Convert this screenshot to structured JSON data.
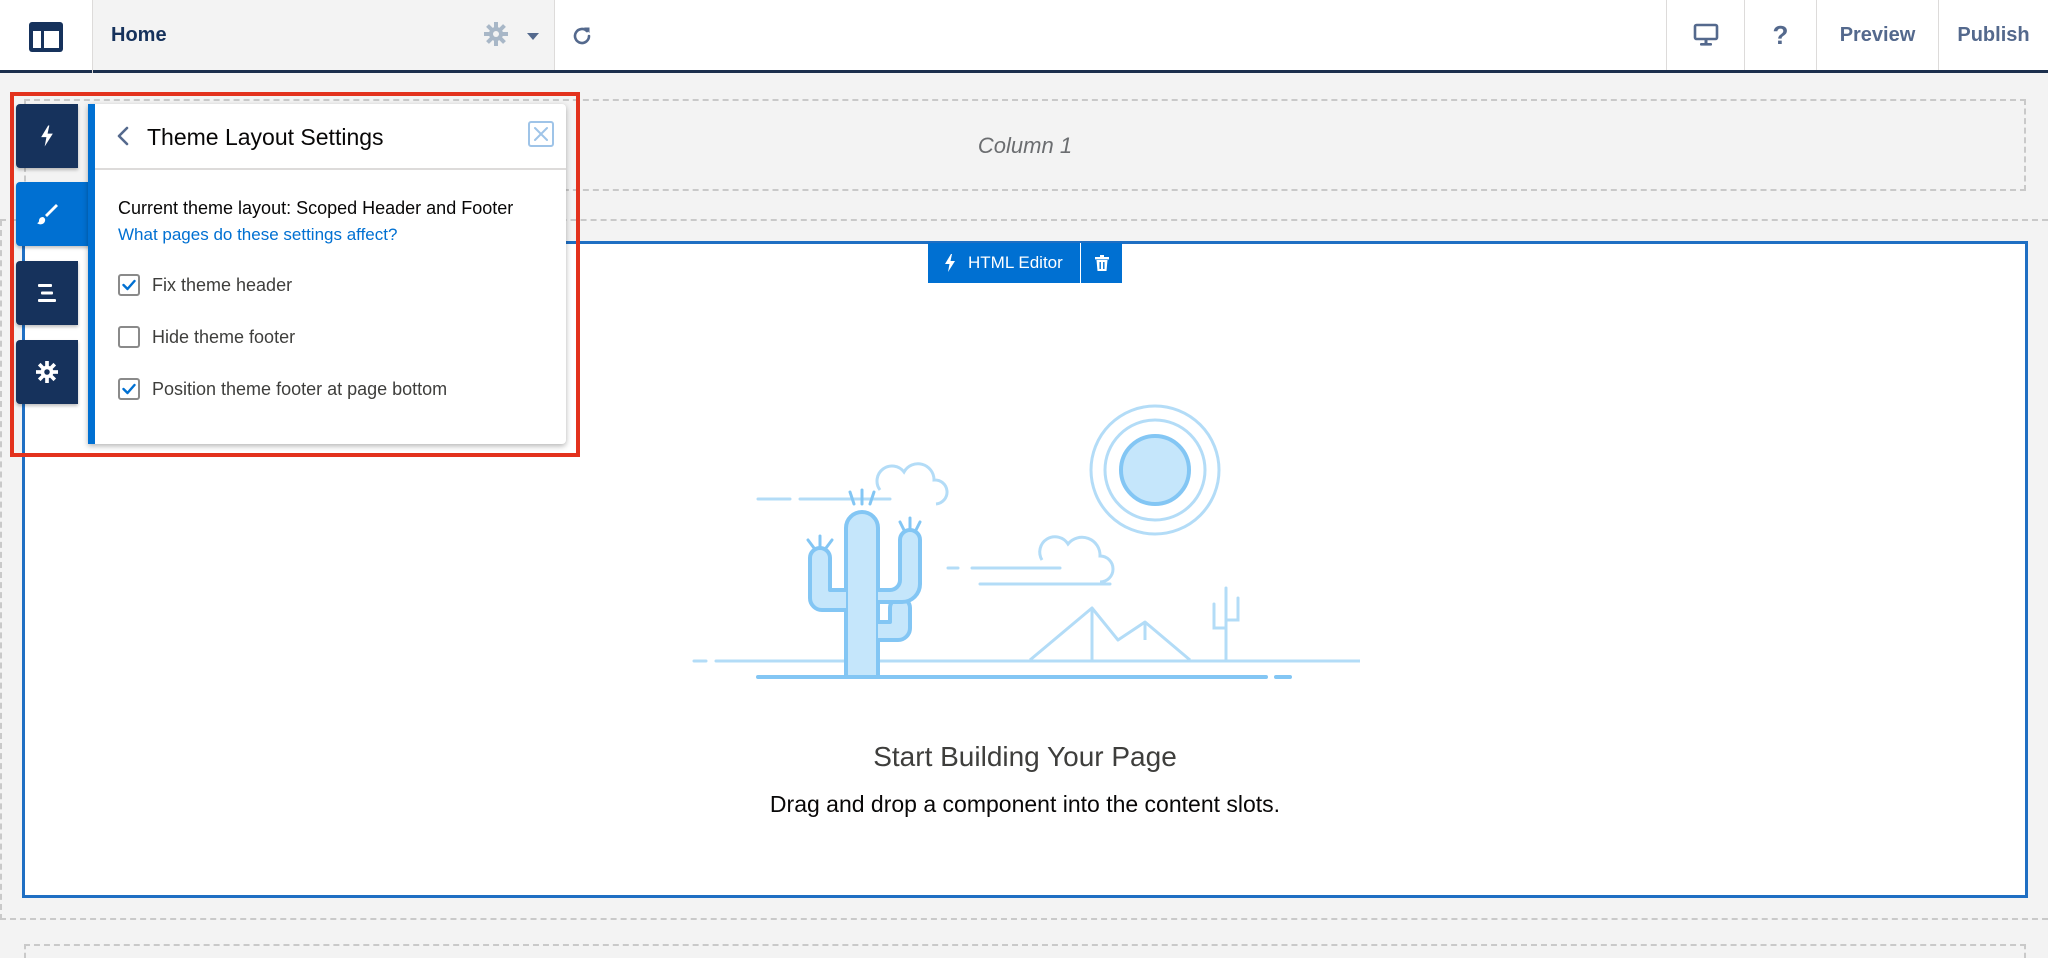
{
  "topbar": {
    "page_name": "Home",
    "preview_label": "Preview",
    "publish_label": "Publish",
    "help_label": "?"
  },
  "canvas": {
    "column_label": "Column 1",
    "component_label": "HTML Editor",
    "empty_title": "Start Building Your Page",
    "empty_subtitle": "Drag and drop a component into the content slots."
  },
  "panel": {
    "title": "Theme Layout Settings",
    "current_layout": "Current theme layout: Scoped Header and Footer",
    "help_link": "What pages do these settings affect?",
    "options": [
      {
        "label": "Fix theme header",
        "checked": true
      },
      {
        "label": "Hide theme footer",
        "checked": false
      },
      {
        "label": "Position theme footer at page bottom",
        "checked": true
      }
    ]
  },
  "side_rail": {
    "items": [
      "lightning-icon",
      "brush-icon",
      "menu-icon",
      "gear-icon"
    ],
    "active_index": 1
  },
  "colors": {
    "brand_blue": "#0070d2",
    "navy": "#16325c",
    "highlight_red": "#e3321d"
  }
}
